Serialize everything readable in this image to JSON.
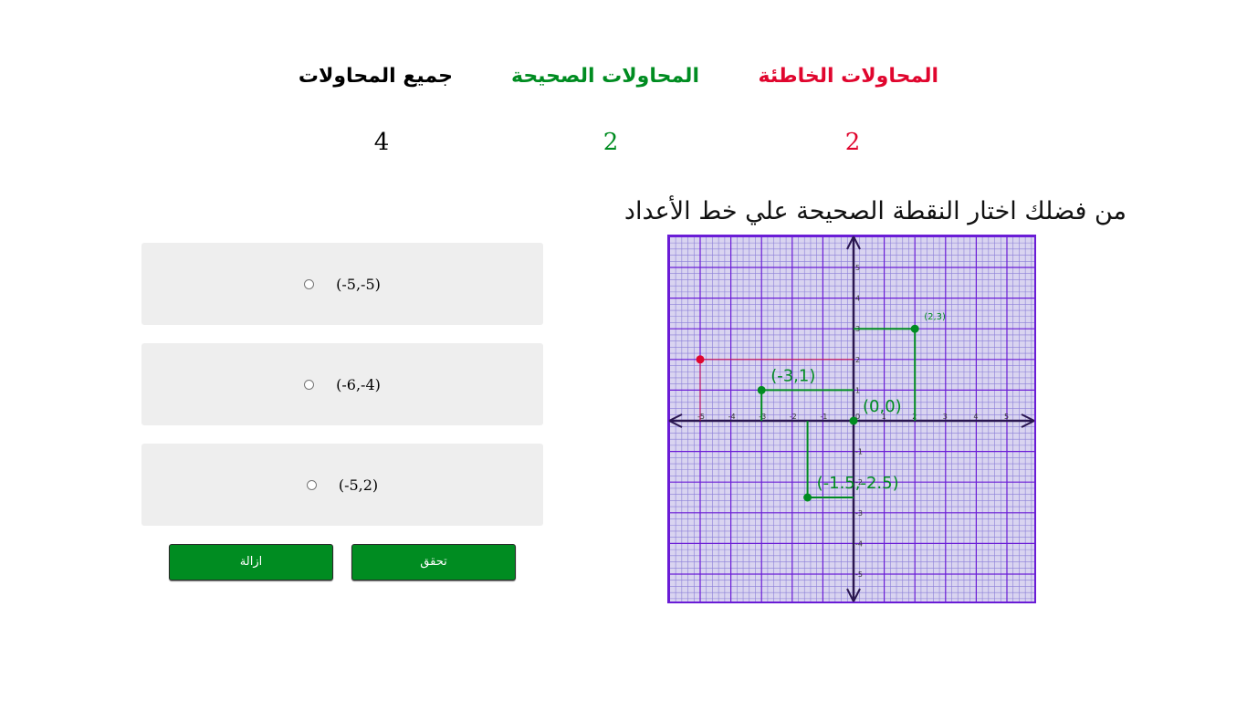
{
  "stats": {
    "total_label": "جميع المحاولات",
    "total_value": "4",
    "correct_label": "المحاولات الصحيحة",
    "correct_value": "2",
    "wrong_label": "المحاولات الخاطئة",
    "wrong_value": "2"
  },
  "question": "من فضلك اختار النقطة الصحيحة علي خط الأعداد",
  "options": [
    {
      "label": "(-5,-5)",
      "selected": false
    },
    {
      "label": "(-6,-4)",
      "selected": false
    },
    {
      "label": "(-5,2)",
      "selected": false
    }
  ],
  "buttons": {
    "check_label": "تحقق",
    "reset_label": "ازالة"
  },
  "colors": {
    "correct": "#008c21",
    "wrong": "#e0062e",
    "grid_major": "#6a1cd6",
    "grid_minor": "#8b7fd8",
    "grid_background": "#d9d4f0",
    "axis": "#2a1650"
  },
  "graph": {
    "x_range": [
      -6,
      6
    ],
    "y_range": [
      -6,
      6
    ],
    "x_ticks": [
      "-5",
      "-4",
      "-3",
      "-2",
      "-1",
      "1",
      "2",
      "3",
      "4",
      "5"
    ],
    "y_ticks": [
      "5",
      "4",
      "3",
      "2",
      "1",
      "-1",
      "-2",
      "-3",
      "-4",
      "-5"
    ],
    "origin_label": "0",
    "correct_points": [
      {
        "x": 2,
        "y": 3,
        "label": "(2,3)",
        "label_size": "small"
      },
      {
        "x": -3,
        "y": 1,
        "label": "(-3,1)",
        "label_size": "large"
      },
      {
        "x": 0,
        "y": 0,
        "label": "(0,0)",
        "label_size": "large"
      },
      {
        "x": -1.5,
        "y": -2.5,
        "label": "(-1.5,-2.5)",
        "label_size": "large"
      }
    ],
    "wrong_points": [
      {
        "x": -5,
        "y": 2
      }
    ]
  }
}
